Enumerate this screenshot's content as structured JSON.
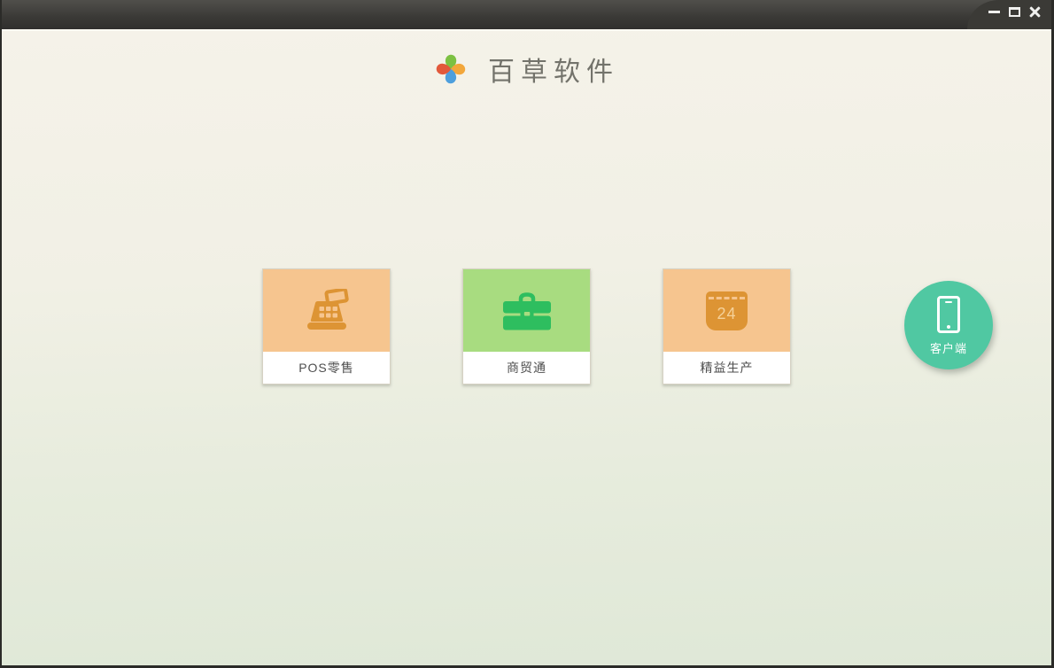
{
  "window": {
    "controls": [
      {
        "name": "minimize"
      },
      {
        "name": "maximize"
      },
      {
        "name": "close"
      }
    ]
  },
  "header": {
    "app_name": "百草软件",
    "logo_icon": "pinwheel-icon",
    "logo_colors": {
      "top": "#7cc142",
      "right": "#f2a73b",
      "bottom": "#4d9fdd",
      "left": "#e2593b"
    }
  },
  "products": [
    {
      "label": "POS零售",
      "icon": "cash-register-icon",
      "tile_color": "#f6c58f",
      "icon_color": "#dd9434"
    },
    {
      "label": "商贸通",
      "icon": "briefcase-icon",
      "tile_color": "#a8dc80",
      "icon_color": "#2ebe5f"
    },
    {
      "label": "精益生产",
      "icon": "calendar-icon",
      "calendar_number": "24",
      "tile_color": "#f6c58f",
      "icon_color": "#dd9434"
    }
  ],
  "client": {
    "label": "客户端",
    "icon": "smartphone-icon",
    "color": "#50c8a2"
  },
  "colors": {
    "titlebar_top": "#504f4b",
    "titlebar_bottom": "#302f2d",
    "frame_border": "#2b2b28",
    "bg_top": "#f5f2e9",
    "bg_bottom": "#dfe8d7",
    "card_bg": "#ffffff",
    "label_text": "#4e4e4e",
    "brand_text": "#73736b"
  }
}
